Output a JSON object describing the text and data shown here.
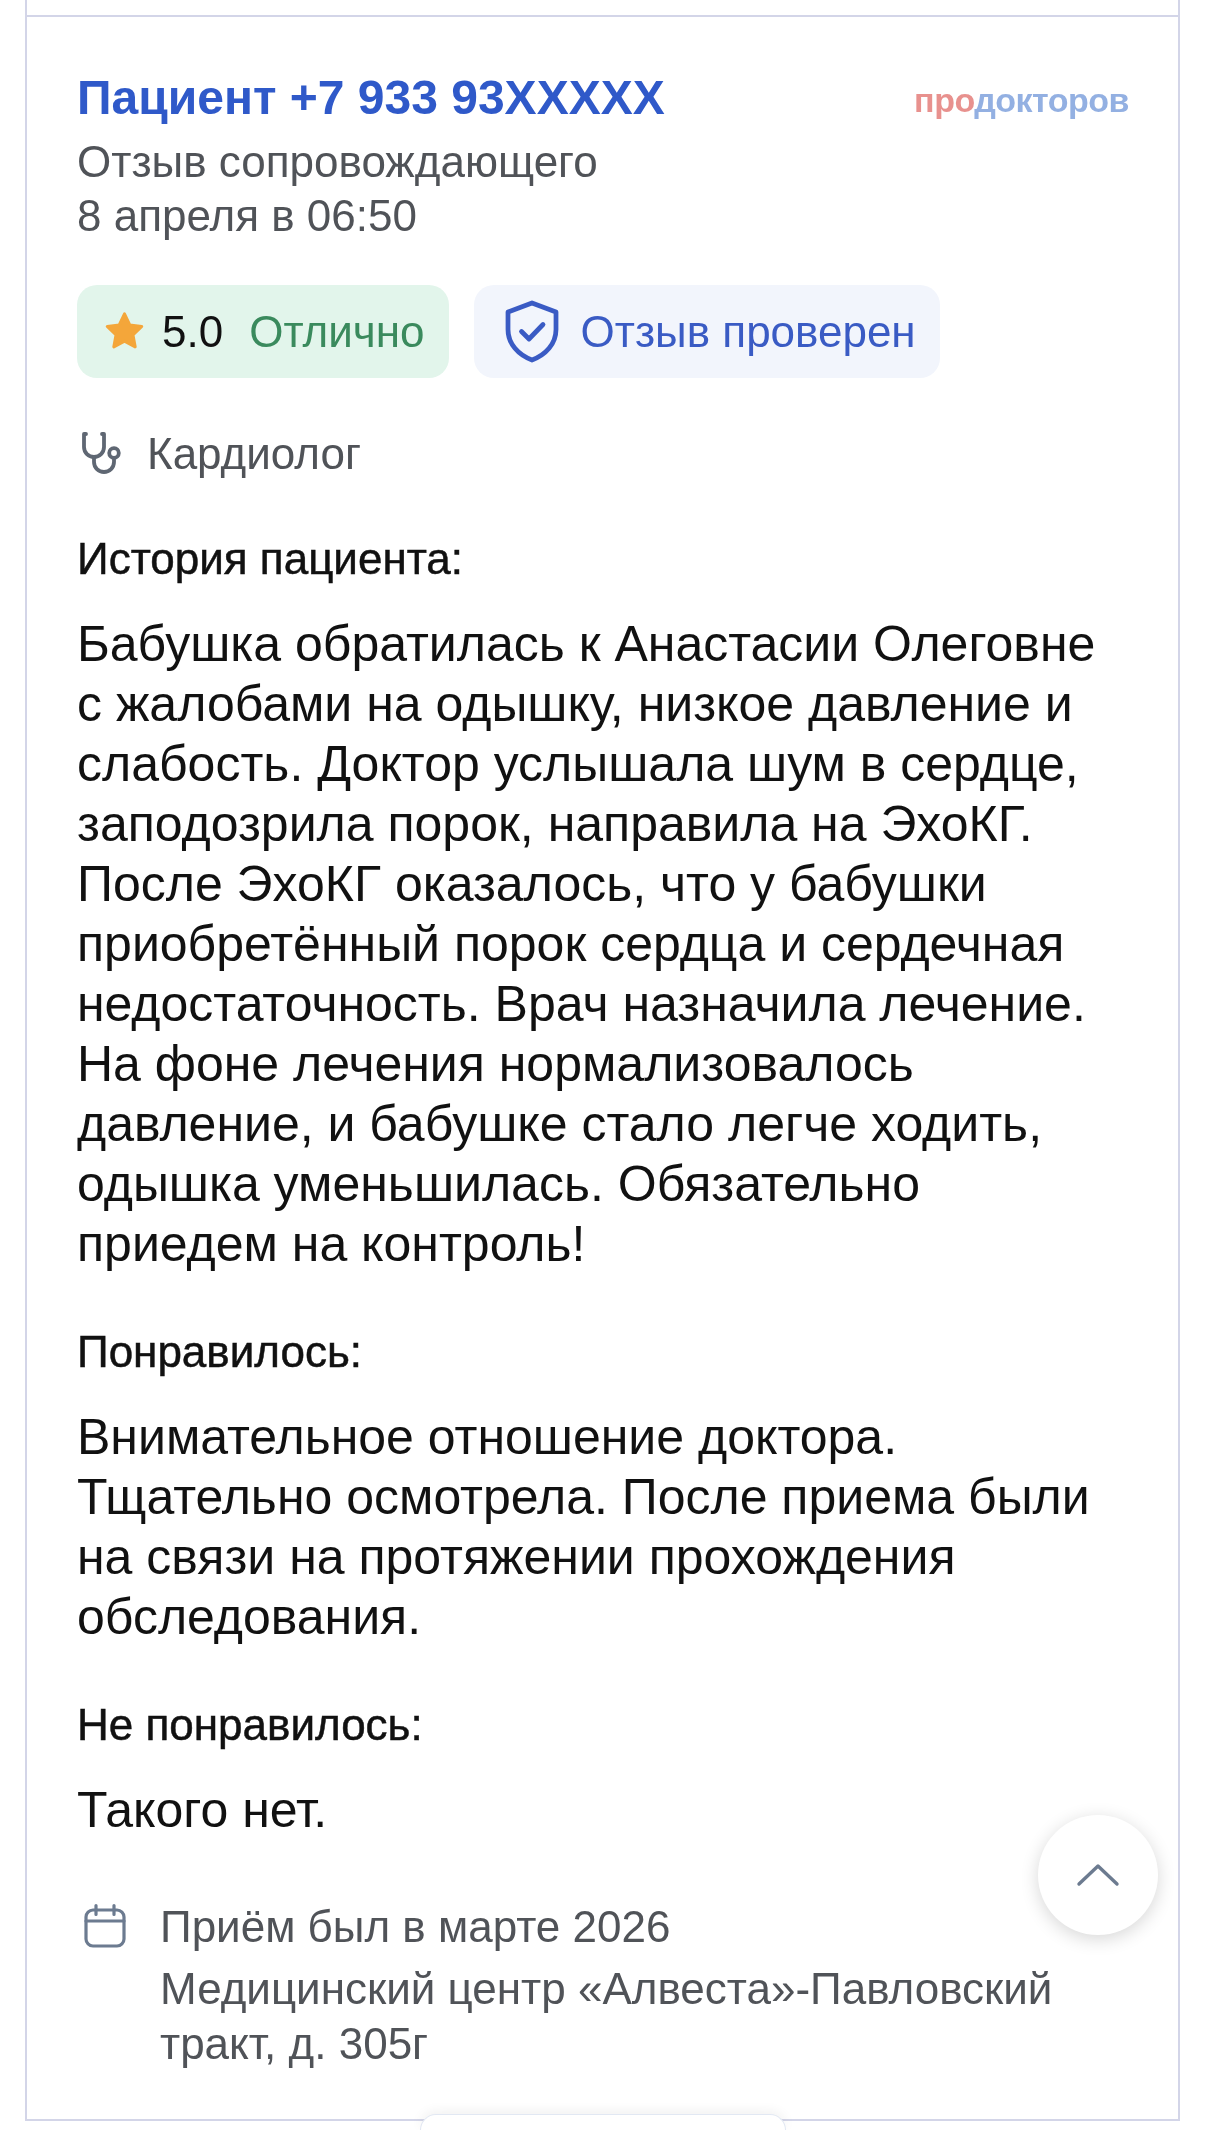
{
  "review": {
    "author": "Пациент +7 933 93XXXXX",
    "logo": [
      {
        "text": "про",
        "color": "#e8918e"
      },
      {
        "text": "докторов",
        "color": "#93b0e2"
      }
    ],
    "review_type": "Отзыв сопровождающего",
    "date": "8 апреля в 06:50",
    "rating": {
      "score": "5.0",
      "label": "Отлично"
    },
    "verified": {
      "label": "Отзыв проверен"
    },
    "specialty": "Кардиолог",
    "sections": [
      {
        "heading": "История пациента:",
        "text": "Бабушка обратилась к Анастасии Олеговне с жалобами на одышку, низкое давление и слабость. Доктор услышала шум в сердце, заподозрила порок, направила на ЭхоКГ. После ЭхоКГ оказалось, что у бабушки приобретённый порок сердца и сердечная недостаточность. Врач назначила лечение. На фоне лечения нормализовалось давление, и бабушке стало легче ходить, одышка уменьшилась. Обязательно приедем на контроль!"
      },
      {
        "heading": "Понравилось:",
        "text": "Внимательное отношение доктора. Тщательно осмотрела. После приема были на связи на протяжении прохождения обследования."
      },
      {
        "heading": "Не понравилось:",
        "text": "Такого нет."
      }
    ],
    "visit": {
      "date": "Приём был в марте 2026",
      "clinic": "Медицинский центр «Алвеста»-Павловский тракт, д. 305г"
    }
  }
}
